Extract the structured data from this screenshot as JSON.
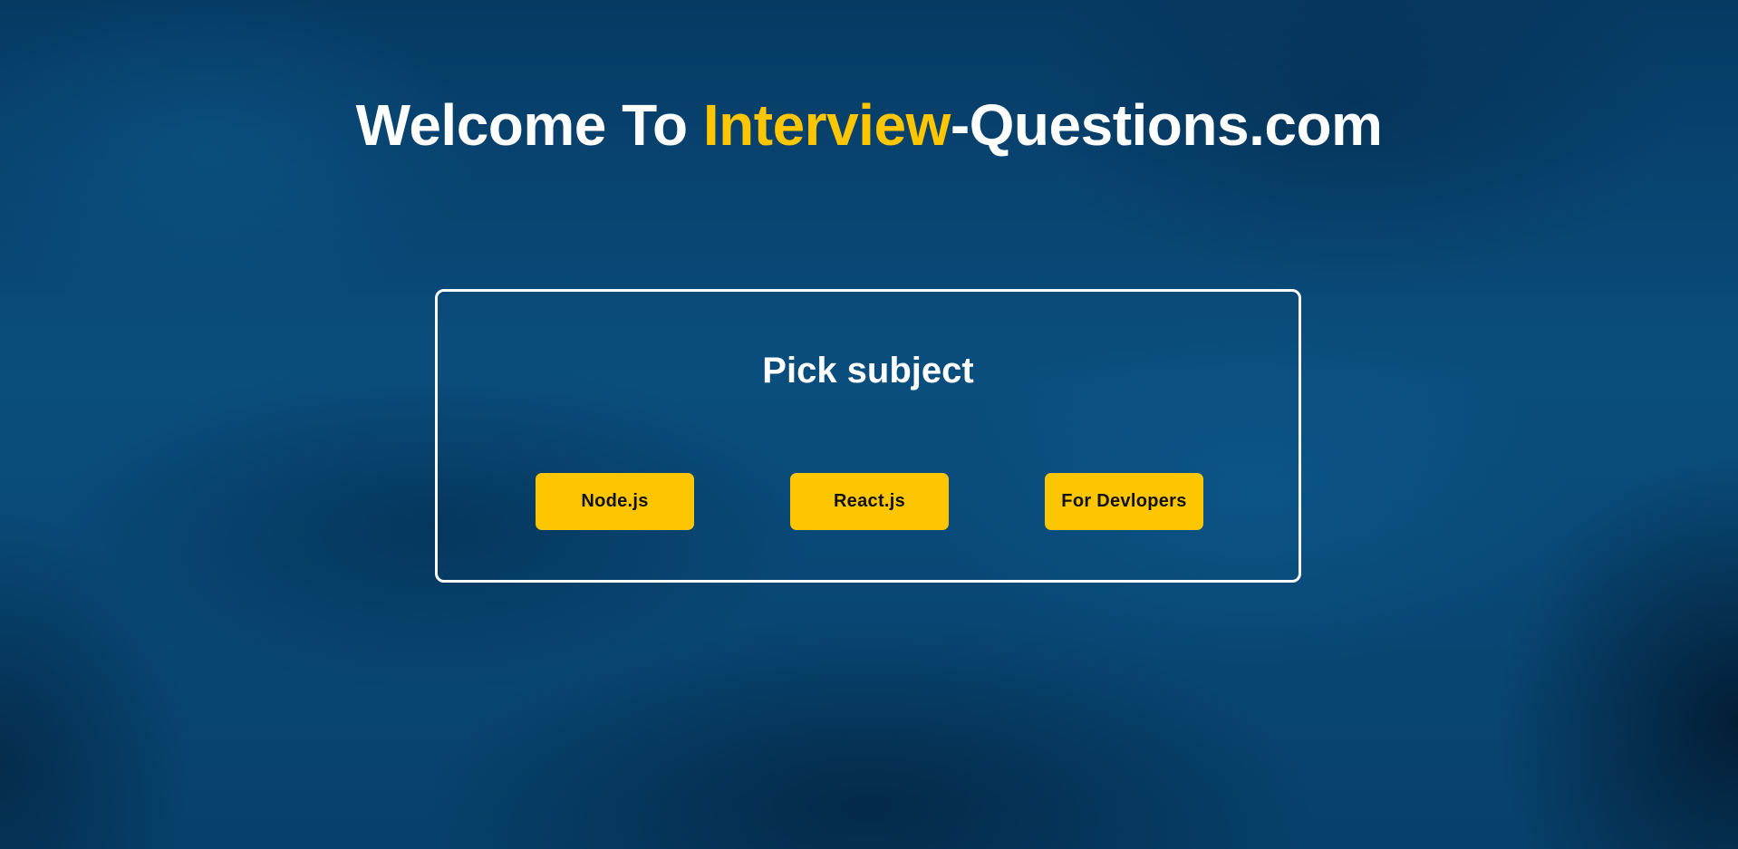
{
  "header": {
    "title_prefix": "Welcome To ",
    "title_highlight": "Interview",
    "title_suffix": "-Questions.com"
  },
  "panel": {
    "heading": "Pick subject",
    "buttons": [
      {
        "label": "Node.js"
      },
      {
        "label": "React.js"
      },
      {
        "label": "For Devlopers"
      }
    ]
  },
  "colors": {
    "accent": "#fdc600",
    "background": "#0b4a78",
    "text": "#ffffff",
    "button_text": "#111111"
  }
}
